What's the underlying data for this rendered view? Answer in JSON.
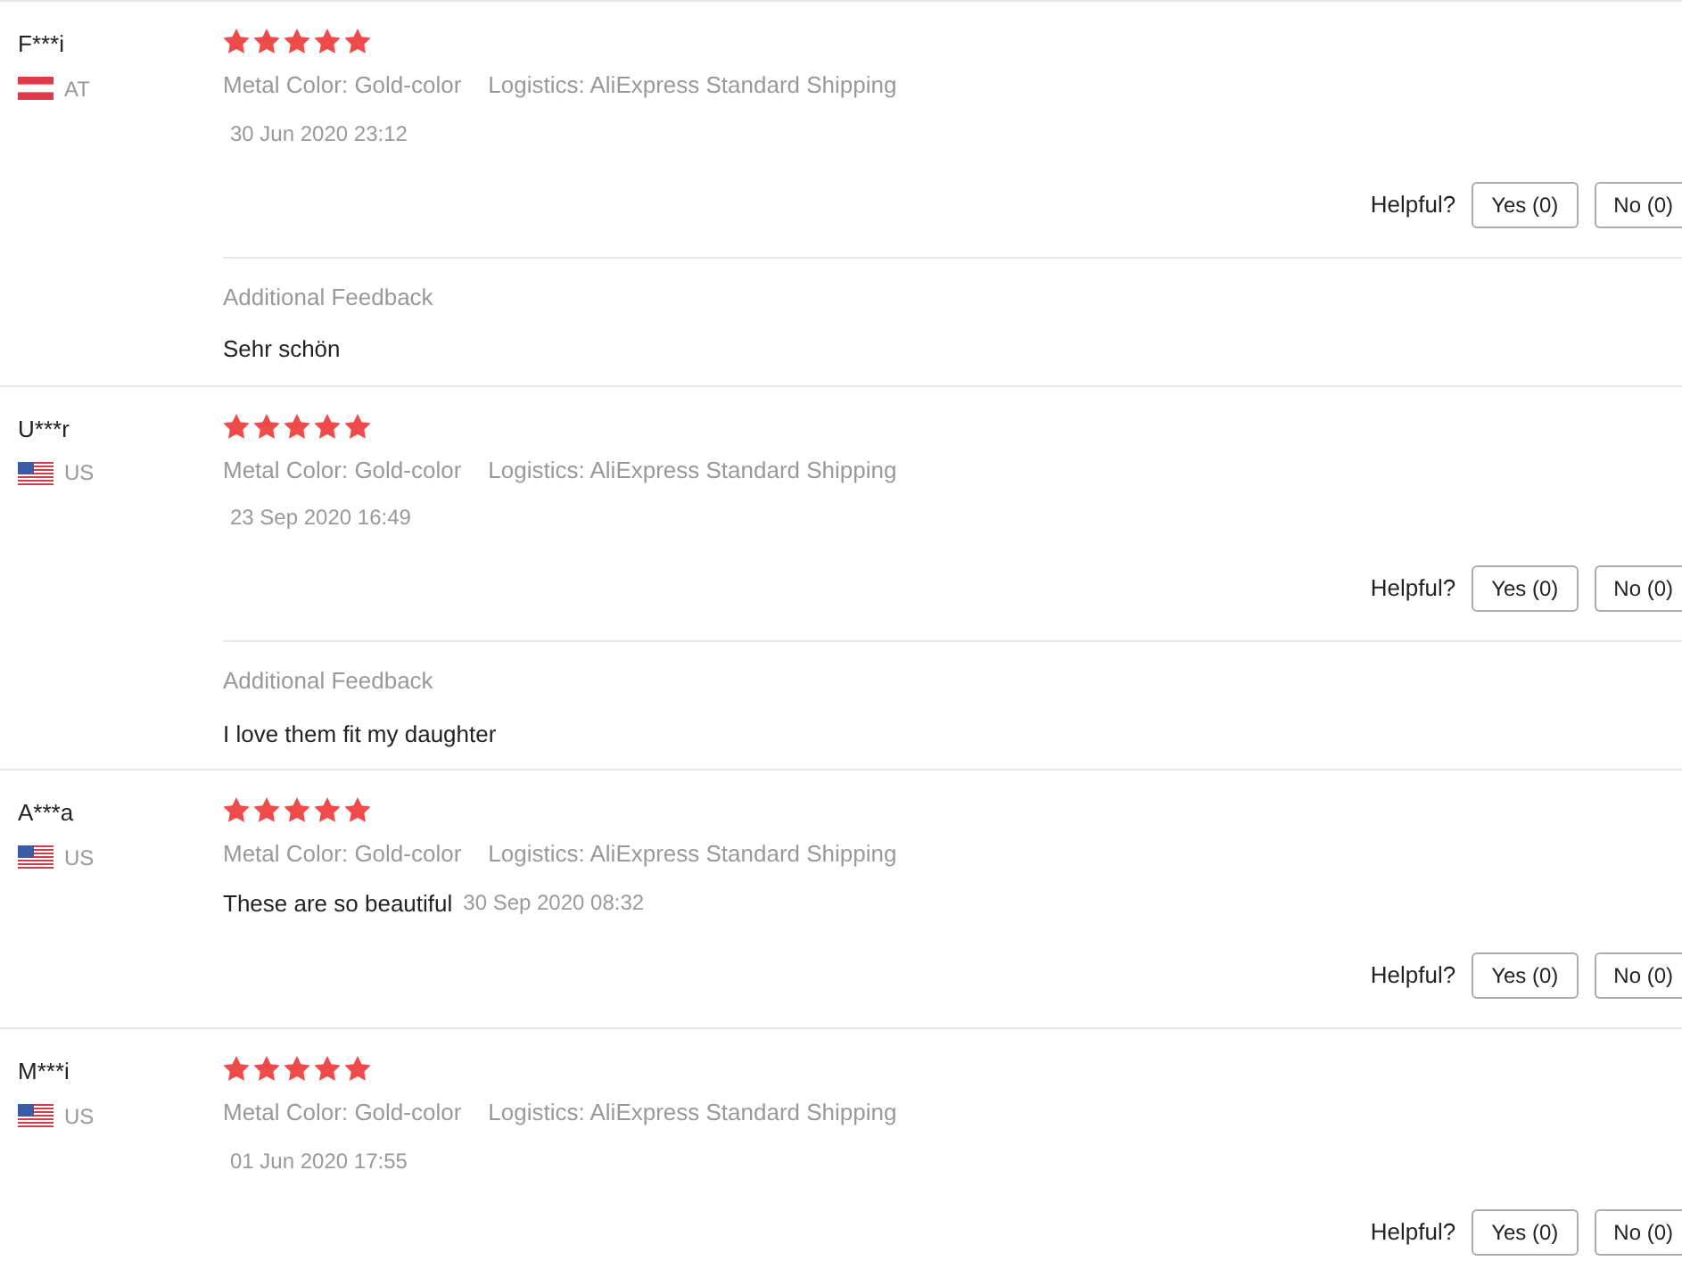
{
  "reviews": [
    {
      "name": "F***i",
      "flag": {
        "kind": "at"
      },
      "country": "AT",
      "stars": 5,
      "attributes": [
        "Metal Color: Gold-color",
        "Logistics: AliExpress Standard Shipping"
      ],
      "date": "30 Jun 2020 23:12",
      "helpful": {
        "label": "Helpful?",
        "yes": "Yes (0)",
        "no": "No (0)"
      },
      "additional_feedback": {
        "label": "Additional Feedback",
        "text": "Sehr schön"
      }
    },
    {
      "name": "U***r",
      "flag": {
        "kind": "us"
      },
      "country": "US",
      "stars": 5,
      "attributes": [
        "Metal Color: Gold-color",
        "Logistics: AliExpress Standard Shipping"
      ],
      "date": "23 Sep 2020 16:49",
      "helpful": {
        "label": "Helpful?",
        "yes": "Yes (0)",
        "no": "No (0)"
      },
      "additional_feedback": {
        "label": "Additional Feedback",
        "text": "I love them fit my daughter"
      }
    },
    {
      "name": "A***a",
      "flag": {
        "kind": "us"
      },
      "country": "US",
      "stars": 5,
      "attributes": [
        "Metal Color: Gold-color",
        "Logistics: AliExpress Standard Shipping"
      ],
      "comment": "These are so beautiful",
      "date": "30 Sep 2020 08:32",
      "helpful": {
        "label": "Helpful?",
        "yes": "Yes (0)",
        "no": "No (0)"
      }
    },
    {
      "name": "M***i",
      "flag": {
        "kind": "us"
      },
      "country": "US",
      "stars": 5,
      "attributes": [
        "Metal Color: Gold-color",
        "Logistics: AliExpress Standard Shipping"
      ],
      "date": "01 Jun 2020 17:55",
      "helpful": {
        "label": "Helpful?",
        "yes": "Yes (0)",
        "no": "No (0)"
      }
    }
  ]
}
